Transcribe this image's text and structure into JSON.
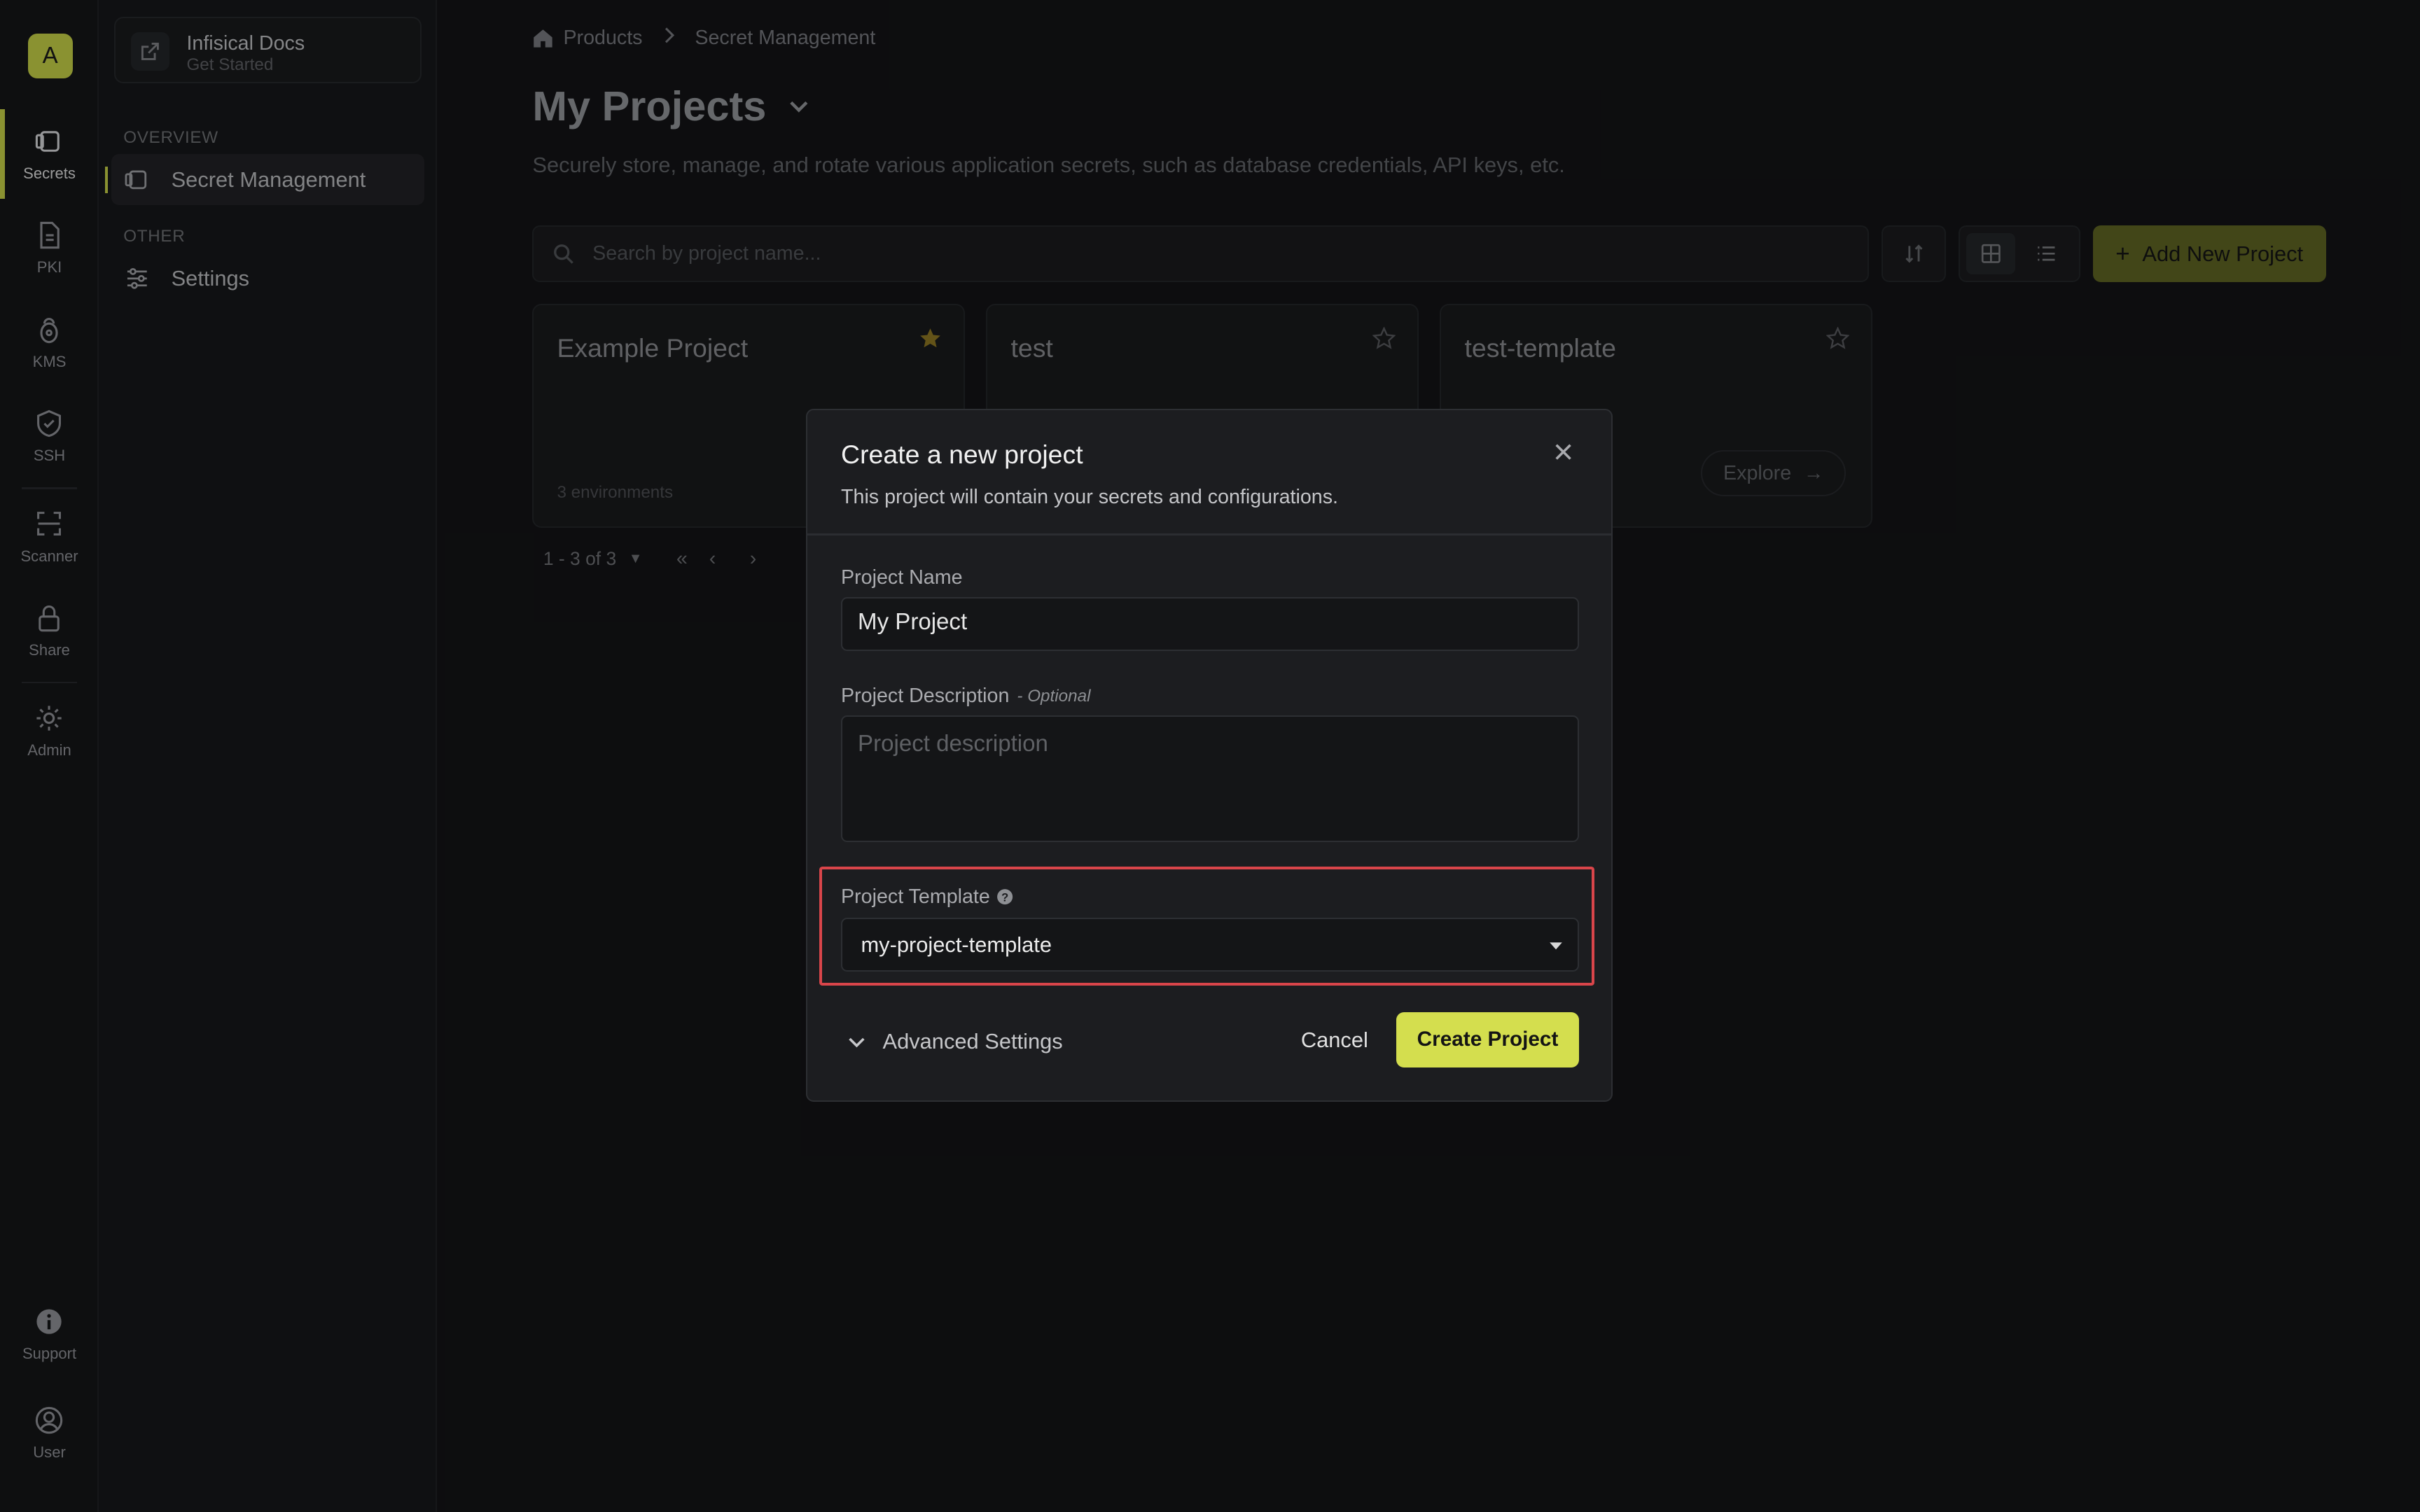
{
  "rail": {
    "org_initial": "A",
    "items": [
      {
        "label": "Secrets",
        "icon": "secrets-icon"
      },
      {
        "label": "PKI",
        "icon": "pki-icon"
      },
      {
        "label": "KMS",
        "icon": "kms-icon"
      },
      {
        "label": "SSH",
        "icon": "ssh-icon"
      },
      {
        "label": "Scanner",
        "icon": "scanner-icon"
      },
      {
        "label": "Share",
        "icon": "share-icon"
      },
      {
        "label": "Admin",
        "icon": "admin-icon"
      },
      {
        "label": "Support",
        "icon": "support-icon"
      },
      {
        "label": "User",
        "icon": "user-icon"
      }
    ]
  },
  "sidebar": {
    "docs_title": "Infisical Docs",
    "docs_subtitle": "Get Started",
    "overview_label": "OVERVIEW",
    "other_label": "OTHER",
    "items": [
      {
        "label": "Secret Management"
      },
      {
        "label": "Settings"
      }
    ]
  },
  "breadcrumb": {
    "home": "Products",
    "current": "Secret Management"
  },
  "page": {
    "title": "My Projects",
    "description": "Securely store, manage, and rotate various application secrets, such as database credentials, API keys, etc."
  },
  "toolbar": {
    "search_placeholder": "Search by project name...",
    "add_label": "Add New Project"
  },
  "projects": [
    {
      "name": "Example Project",
      "environments": "3 environments",
      "starred": true
    },
    {
      "name": "test",
      "starred": false
    },
    {
      "name": "test-template",
      "explore_label": "Explore",
      "starred": false
    }
  ],
  "pagination": {
    "range": "1 - 3 of 3"
  },
  "modal": {
    "title": "Create a new project",
    "subtitle": "This project will contain your secrets and configurations.",
    "name_label": "Project Name",
    "name_value": "My Project",
    "description_label": "Project Description",
    "description_optional": "- Optional",
    "description_placeholder": "Project description",
    "template_label": "Project Template",
    "template_value": "my-project-template",
    "advanced_label": "Advanced Settings",
    "cancel_label": "Cancel",
    "create_label": "Create Project"
  },
  "colors": {
    "accent": "#d4de4e",
    "highlight": "#d9454a"
  }
}
